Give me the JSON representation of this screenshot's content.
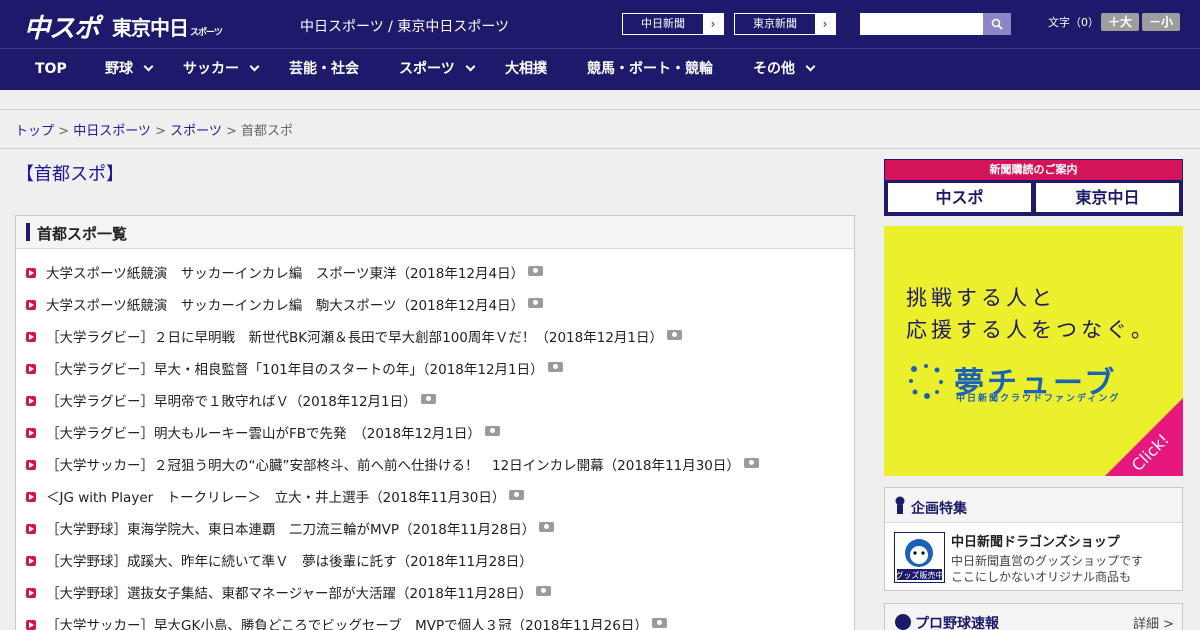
{
  "header": {
    "logo_chuspo": "中スポ",
    "logo_tokyo": "東京中日",
    "logo_tokyo_small": "スポーツ",
    "site_name": "中日スポーツ / 東京中日スポーツ",
    "paper_buttons": [
      "中日新聞",
      "東京新聞"
    ],
    "search_placeholder": "",
    "font_label": "文字（0）",
    "font_up": "＋大",
    "font_down": "－小"
  },
  "nav": [
    "TOP",
    "野球",
    "サッカー",
    "芸能・社会",
    "スポーツ",
    "大相撲",
    "競馬・ボート・競輪",
    "その他"
  ],
  "breadcrumb": {
    "items": [
      "トップ",
      "中日スポーツ",
      "スポーツ"
    ],
    "current": "首都スポ",
    "sep": " > "
  },
  "page_title": "【首都スポ】",
  "list": {
    "heading": "首都スポ一覧",
    "items": [
      {
        "text": "大学スポーツ紙競演　サッカーインカレ編　スポーツ東洋（2018年12月4日）",
        "photo": true
      },
      {
        "text": "大学スポーツ紙競演　サッカーインカレ編　駒大スポーツ（2018年12月4日）",
        "photo": true
      },
      {
        "text": "［大学ラグビー］２日に早明戦　新世代BK河瀬＆長田で早大創部100周年Ｖだ！（2018年12月1日）",
        "photo": true
      },
      {
        "text": "［大学ラグビー］早大・相良監督「101年目のスタートの年」（2018年12月1日）",
        "photo": true
      },
      {
        "text": "［大学ラグビー］早明帝で１敗守ればＶ（2018年12月1日）",
        "photo": true
      },
      {
        "text": "［大学ラグビー］明大もルーキー雲山がFBで先発　（2018年12月1日）",
        "photo": true
      },
      {
        "text": "［大学サッカー］２冠狙う明大の“心臓”安部柊斗、前へ前へ仕掛ける！　12日インカレ開幕（2018年11月30日）",
        "photo": true
      },
      {
        "text": "＜JG with Player　トークリレー＞　立大・井上選手（2018年11月30日）",
        "photo": true
      },
      {
        "text": "［大学野球］東海学院大、東日本連覇　二刀流三輪がMVP（2018年11月28日）",
        "photo": true
      },
      {
        "text": "［大学野球］成蹊大、昨年に続いて準Ｖ　夢は後輩に託す（2018年11月28日）",
        "photo": false
      },
      {
        "text": "［大学野球］選抜女子集結、東都マネージャー部が大活躍（2018年11月28日）",
        "photo": true
      },
      {
        "text": "［大学サッカー］早大GK小島、勝負どころでビッグセーブ　MVPで個人３冠（2018年11月26日）",
        "photo": true
      }
    ]
  },
  "sidebar": {
    "subscribe_heading": "新聞購読のご案内",
    "subscribe_logos": [
      "中スポ",
      "東京中日"
    ],
    "ad": {
      "line1": "挑戦する人と",
      "line2": "応援する人をつなぐ。",
      "brand": "夢チューブ",
      "brand_sub": "中日新聞クラウドファンディング",
      "click": "Click!",
      "bg_color": "#ecf02c",
      "accent_color": "#e6177e"
    },
    "feature": {
      "heading": "企画特集",
      "shop_title": "中日新聞ドラゴンズショップ",
      "shop_desc1": "中日新聞直営のグッズショップです",
      "shop_desc2": "ここにしかないオリジナル商品も",
      "shop_img_label": "グッズ販売中"
    },
    "baseball": {
      "heading": "プロ野球速報",
      "more": "詳細 >"
    }
  },
  "colors": {
    "brand": "#1d1a6b",
    "link": "#1d1a9a",
    "bullet": "#d4145a"
  }
}
